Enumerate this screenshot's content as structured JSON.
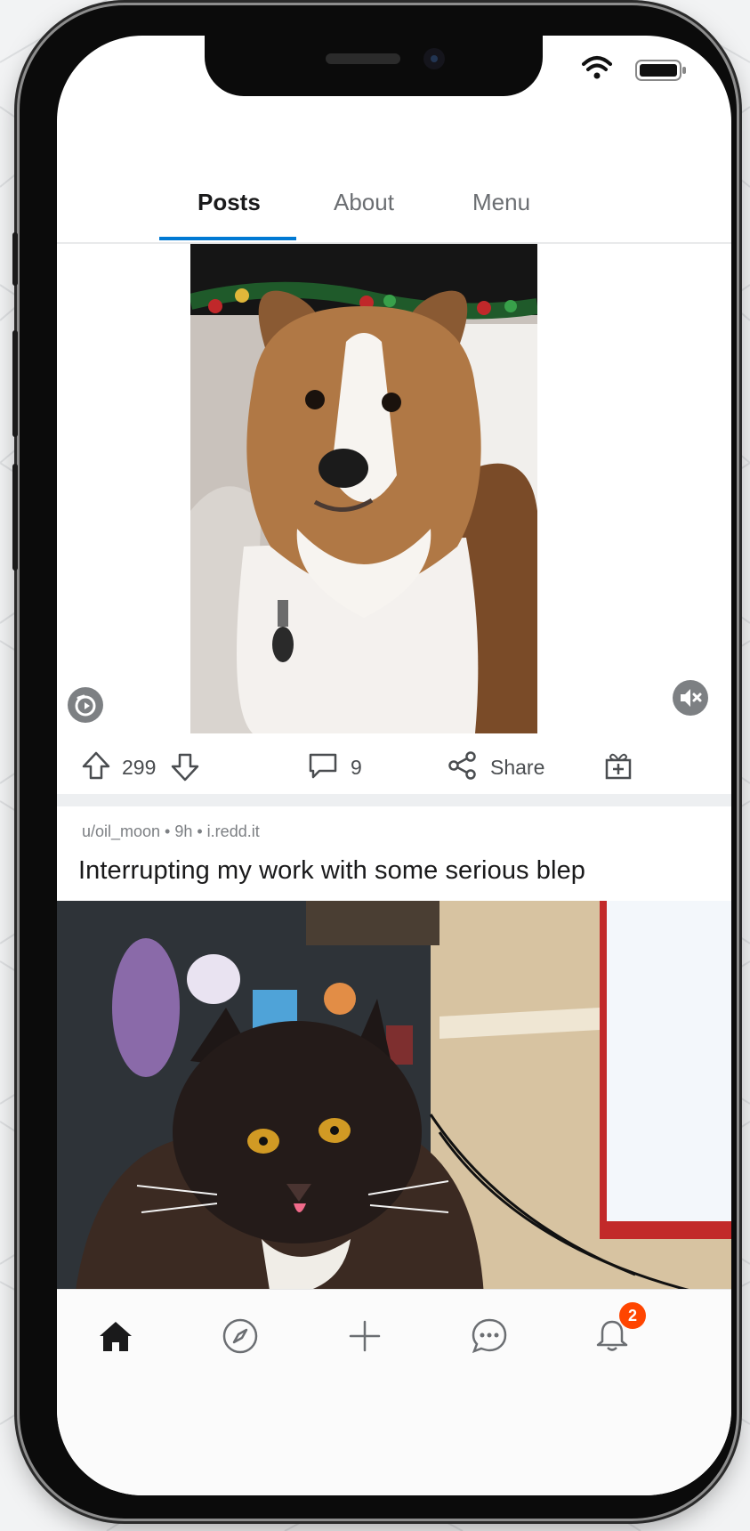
{
  "tabs": [
    {
      "label": "Posts",
      "active": true
    },
    {
      "label": "About",
      "active": false
    },
    {
      "label": "Menu",
      "active": false
    }
  ],
  "post1": {
    "media_subject": "dog",
    "upvotes": "299",
    "comments": "9",
    "share_label": "Share",
    "audio": "muted"
  },
  "post2": {
    "meta": "u/oil_moon • 9h • i.redd.it",
    "title": "Interrupting my work with some serious blep",
    "media_subject": "cat"
  },
  "nav": {
    "items": [
      {
        "name": "home",
        "icon": "home-icon"
      },
      {
        "name": "discover",
        "icon": "compass-icon"
      },
      {
        "name": "create",
        "icon": "plus-icon"
      },
      {
        "name": "chat",
        "icon": "chat-icon"
      },
      {
        "name": "notifications",
        "icon": "bell-icon"
      }
    ],
    "notification_badge": "2"
  },
  "colors": {
    "accent": "#0079d3",
    "badge": "#ff4500",
    "text": "#1a1a1b"
  }
}
